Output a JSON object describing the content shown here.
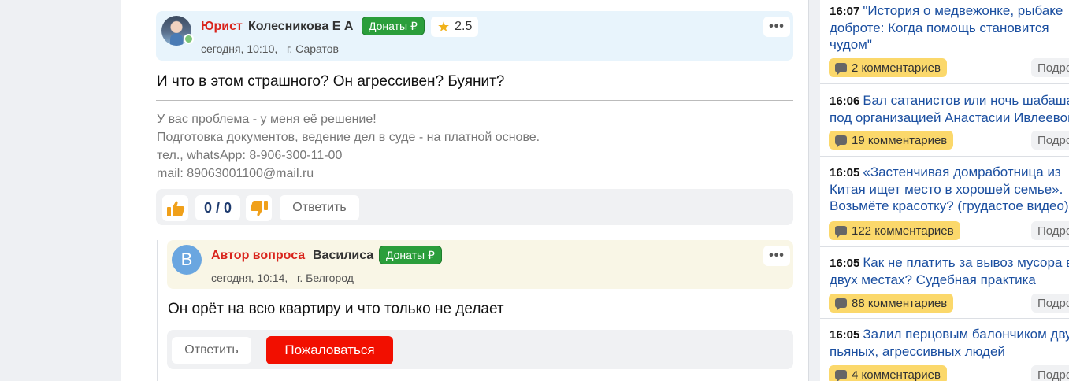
{
  "comment1": {
    "role": "Юрист",
    "username": "Колесникова Е А",
    "donate_label": "Донаты ₽",
    "rating": "2.5",
    "meta_time": "сегодня, 10:10,",
    "meta_city": "г. Саратов",
    "text": "И что в этом страшного? Он агрессивен? Буянит?",
    "signature": [
      "У вас проблема - у меня её решение!",
      "Подготовка документов, ведение дел в суде - на платной основе.",
      "тел., whatsApp: 8-906-300-11-00",
      "mail: 89063001100@mail.ru"
    ],
    "score": "0 / 0",
    "reply_label": "Ответить"
  },
  "comment2": {
    "avatar_letter": "В",
    "role": "Автор вопроса",
    "username": "Василиса",
    "donate_label": "Донаты ₽",
    "meta_time": "сегодня, 10:14,",
    "meta_city": "г. Белгород",
    "text": "Он орёт на всю квартиру и что только не делает",
    "reply_label": "Ответить",
    "report_label": "Пожаловаться"
  },
  "more_label": "•••",
  "sidebar": {
    "news": [
      {
        "time": "16:07",
        "lines": [
          "\"История о медвежонке, рыбаке",
          "доброте: Когда помощь становится",
          "чудом\""
        ],
        "comments": "2 комментариев",
        "more": "Подробнее"
      },
      {
        "time": "16:06",
        "lines": [
          "Бал сатанистов или ночь шабаша",
          "под организацией Анастасии Ивлеевой"
        ],
        "comments": "19 комментариев",
        "more": "Подробнее"
      },
      {
        "time": "16:05",
        "lines": [
          "«Застенчивая домработница из",
          "Китая ищет место в хорошей семье».",
          "Возьмёте красотку? (грудастое видео)"
        ],
        "comments": "122 комментариев",
        "more": "Подробнее"
      },
      {
        "time": "16:05",
        "lines": [
          "Как не платить за вывоз мусора в",
          "двух местах? Судебная практика"
        ],
        "comments": "88 комментариев",
        "more": "Подробнее"
      },
      {
        "time": "16:05",
        "lines": [
          "Залил перцовым балончиком двух",
          "пьяных, агрессивных людей"
        ],
        "comments": "4 комментариев",
        "more": "Подробнее"
      }
    ]
  }
}
